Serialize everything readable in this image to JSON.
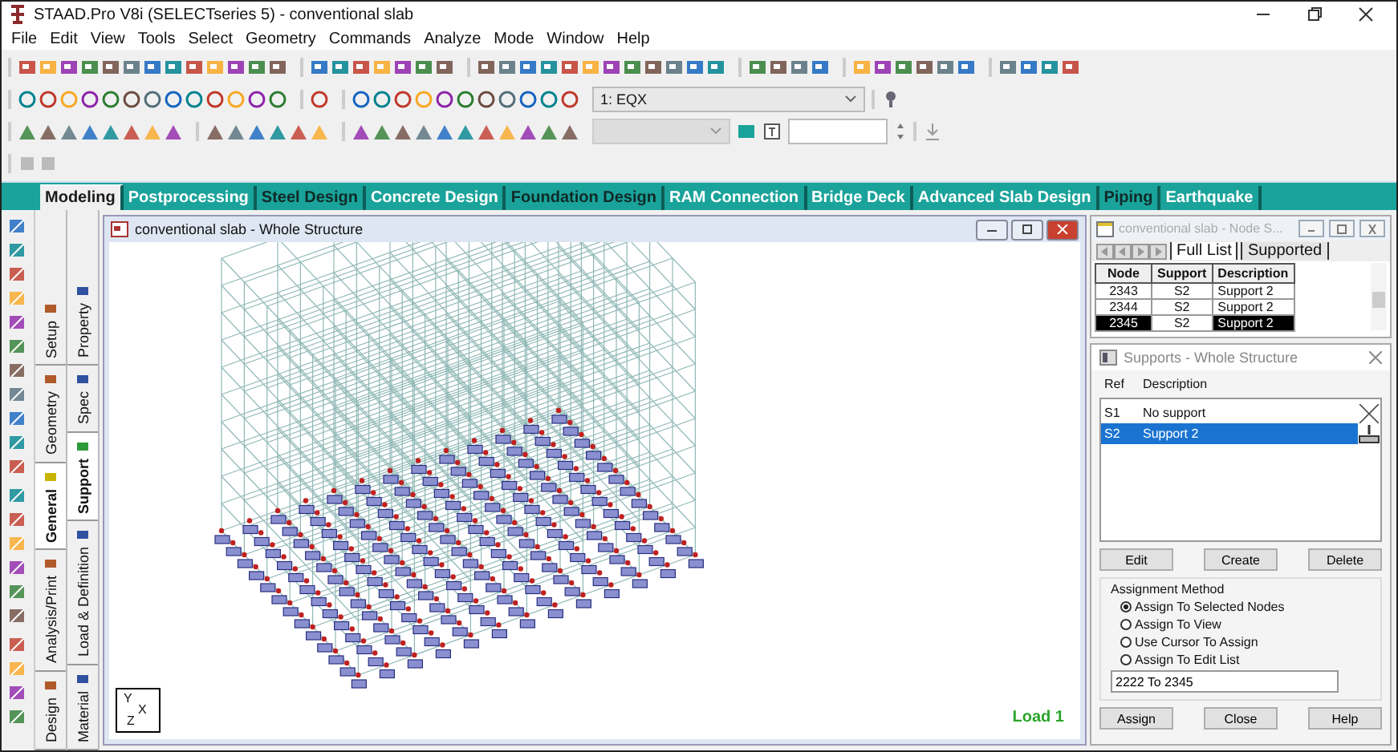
{
  "window": {
    "title": "STAAD.Pro V8i (SELECTseries 5) - conventional slab"
  },
  "menu": [
    "File",
    "Edit",
    "View",
    "Tools",
    "Select",
    "Geometry",
    "Commands",
    "Analyze",
    "Mode",
    "Window",
    "Help"
  ],
  "load_case": {
    "value": "1: EQX"
  },
  "page_tabs": [
    {
      "label": "Modeling",
      "selected": true,
      "color": "#1a1a1a"
    },
    {
      "label": "Postprocessing",
      "selected": false,
      "color": "#ffffff"
    },
    {
      "label": "Steel Design",
      "selected": false,
      "color": "#102a28"
    },
    {
      "label": "Concrete Design",
      "selected": false,
      "color": "#ffffff"
    },
    {
      "label": "Foundation Design",
      "selected": false,
      "color": "#102a28"
    },
    {
      "label": "RAM Connection",
      "selected": false,
      "color": "#ffffff"
    },
    {
      "label": "Bridge Deck",
      "selected": false,
      "color": "#ffffff"
    },
    {
      "label": "Advanced Slab Design",
      "selected": false,
      "color": "#ffffff"
    },
    {
      "label": "Piping",
      "selected": false,
      "color": "#102a28"
    },
    {
      "label": "Earthquake",
      "selected": false,
      "color": "#ffffff"
    }
  ],
  "group_tabs": [
    {
      "label": "Setup",
      "selected": false
    },
    {
      "label": "Geometry",
      "selected": false
    },
    {
      "label": "General",
      "selected": true
    },
    {
      "label": "Analysis/Print",
      "selected": false
    },
    {
      "label": "Design",
      "selected": false
    }
  ],
  "sub_tabs": [
    {
      "label": "Property",
      "selected": false
    },
    {
      "label": "Spec",
      "selected": false
    },
    {
      "label": "Support",
      "selected": true
    },
    {
      "label": "Load & Definition",
      "selected": false
    },
    {
      "label": "Material",
      "selected": false
    }
  ],
  "viewport": {
    "title": "conventional slab - Whole Structure",
    "axis_labels": [
      "Y",
      "X",
      "Z"
    ],
    "load_label": "Load 1"
  },
  "node_table": {
    "title": "conventional slab - Node S...",
    "tabs": [
      {
        "label": "Full List",
        "selected": true
      },
      {
        "label": "Supported",
        "selected": false
      }
    ],
    "columns": [
      "Node",
      "Support",
      "Description"
    ],
    "rows": [
      {
        "cells": [
          "2343",
          "S2",
          "Support 2"
        ],
        "selected": false
      },
      {
        "cells": [
          "2344",
          "S2",
          "Support 2"
        ],
        "selected": false
      },
      {
        "cells": [
          "2345",
          "S2",
          "Support 2"
        ],
        "selected": true
      }
    ]
  },
  "supports": {
    "title": "Supports - Whole Structure",
    "columns": [
      "Ref",
      "Description"
    ],
    "items": [
      {
        "ref": "S1",
        "description": "No support",
        "kind": "none",
        "selected": false
      },
      {
        "ref": "S2",
        "description": "Support 2",
        "kind": "fixed",
        "selected": true
      }
    ],
    "buttons": [
      "Edit",
      "Create",
      "Delete"
    ],
    "method_label": "Assignment Method",
    "methods": [
      {
        "label": "Assign To Selected Nodes",
        "selected": true
      },
      {
        "label": "Assign To View",
        "selected": false
      },
      {
        "label": "Use Cursor To Assign",
        "selected": false
      },
      {
        "label": "Assign To Edit List",
        "selected": false
      }
    ],
    "edit_list": "2222 To 2345",
    "footer_buttons": [
      "Assign",
      "Close",
      "Help"
    ]
  }
}
